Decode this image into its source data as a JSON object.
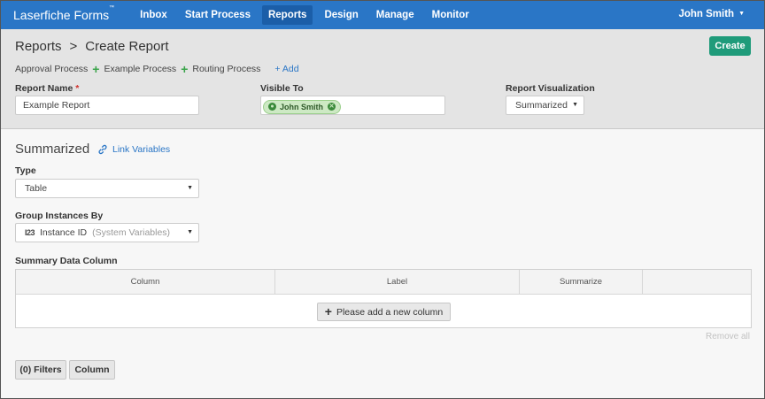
{
  "nav": {
    "brand": "Laserfiche Forms",
    "brand_mark": "™",
    "items": [
      {
        "label": "Inbox",
        "active": false
      },
      {
        "label": "Start Process",
        "active": false
      },
      {
        "label": "Reports",
        "active": true
      },
      {
        "label": "Design",
        "active": false
      },
      {
        "label": "Manage",
        "active": false
      },
      {
        "label": "Monitor",
        "active": false
      }
    ],
    "user": "John Smith"
  },
  "header": {
    "breadcrumb": {
      "root": "Reports",
      "separator": ">",
      "current": "Create Report"
    },
    "create_label": "Create",
    "processes": [
      "Approval Process",
      "Example Process",
      "Routing Process"
    ],
    "add_label": "+ Add",
    "report_name": {
      "label": "Report Name",
      "required_mark": "*",
      "value": "Example Report"
    },
    "visible_to": {
      "label": "Visible To",
      "chip": "John Smith"
    },
    "visualization": {
      "label": "Report Visualization",
      "value": "Summarized"
    }
  },
  "main": {
    "title": "Summarized",
    "link_variables": "Link Variables",
    "type": {
      "label": "Type",
      "value": "Table"
    },
    "group_by": {
      "label": "Group Instances By",
      "icon_text": "I23",
      "value": "Instance ID",
      "hint": "(System Variables)"
    },
    "summary": {
      "label": "Summary Data Column",
      "columns": [
        "Column",
        "Label",
        "Summarize",
        ""
      ],
      "add_column_label": "Please add a new column"
    },
    "remove_all": "Remove all",
    "filters_label": "(0) Filters",
    "column_label": "Column"
  },
  "colors": {
    "nav_bg": "#2a76c6",
    "nav_active": "#1b5ea8",
    "create_btn": "#1f9b7a",
    "link": "#2a76c6",
    "plus_green": "#3aa44a",
    "chip_bg": "#cde9c4"
  }
}
